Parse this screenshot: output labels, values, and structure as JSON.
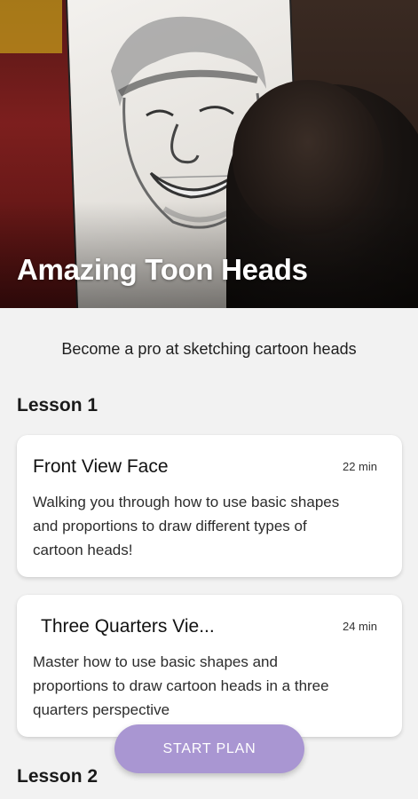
{
  "hero": {
    "title": "Amazing Toon Heads"
  },
  "subtitle": "Become a pro at sketching cartoon heads",
  "lessons": [
    {
      "heading": "Lesson 1",
      "cards": [
        {
          "title": "Front View Face",
          "duration": "22 min",
          "description": "Walking you through how to use basic shapes and proportions to draw different types of cartoon heads!"
        },
        {
          "title": "Three Quarters Vie...",
          "duration": "24 min",
          "description": "Master how to use basic shapes and proportions to draw cartoon heads in a three quarters perspective"
        }
      ]
    },
    {
      "heading": "Lesson 2"
    }
  ],
  "start_button": {
    "label": "START PLAN"
  },
  "colors": {
    "accent": "#a996d2",
    "background": "#f2f2f2",
    "card": "#ffffff"
  }
}
